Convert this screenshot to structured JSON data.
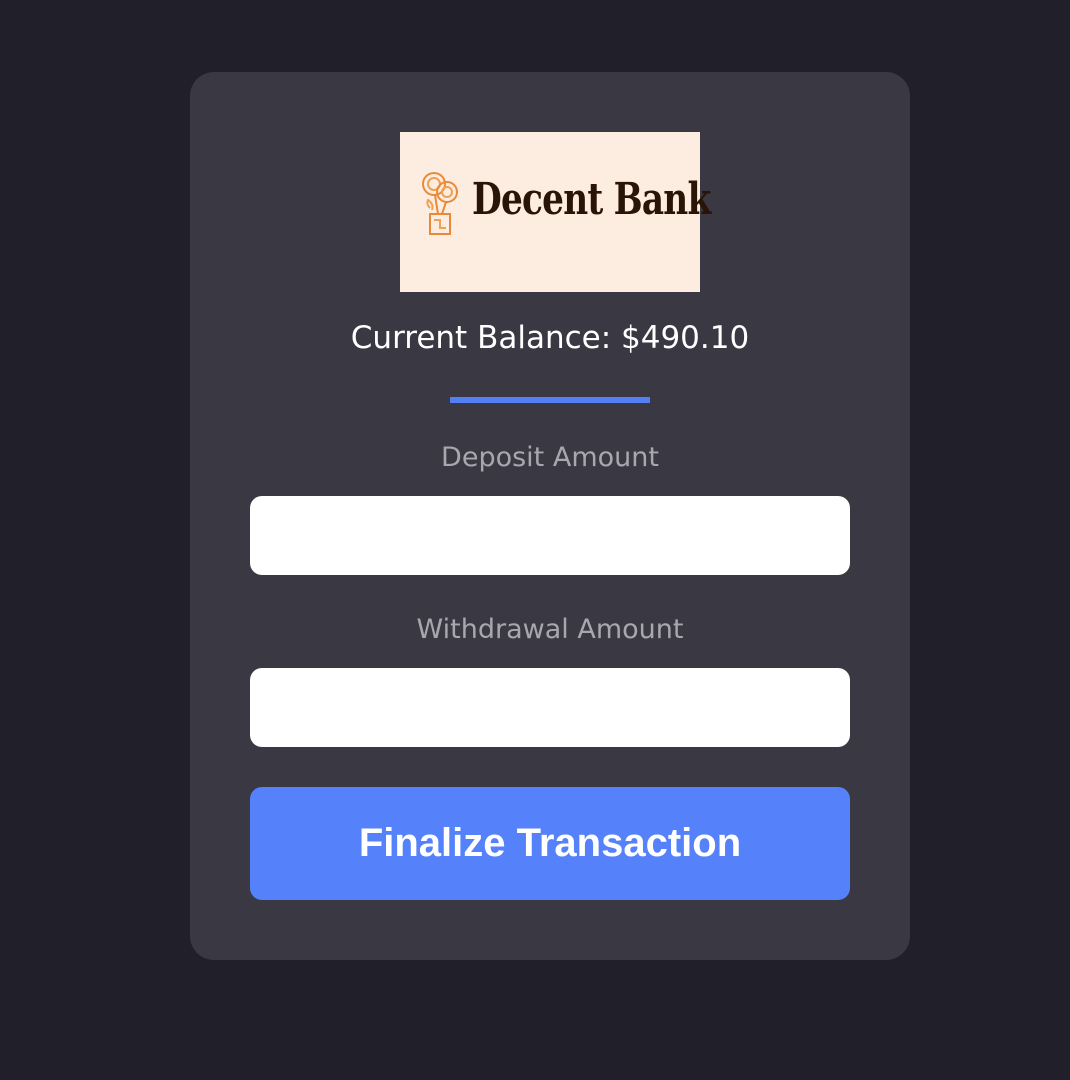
{
  "logo": {
    "name": "Decent Bank",
    "icon": "flower-pot-coin-icon",
    "background": "#fdece0"
  },
  "balance": {
    "text": "Current Balance: $490.10"
  },
  "deposit": {
    "label": "Deposit Amount",
    "value": "",
    "placeholder": ""
  },
  "withdrawal": {
    "label": "Withdrawal Amount",
    "value": "",
    "placeholder": ""
  },
  "submit": {
    "label": "Finalize Transaction"
  },
  "colors": {
    "page_background": "#21202a",
    "card_background": "#3a3843",
    "accent": "#5582fa",
    "label_text": "#a8a7ae"
  }
}
